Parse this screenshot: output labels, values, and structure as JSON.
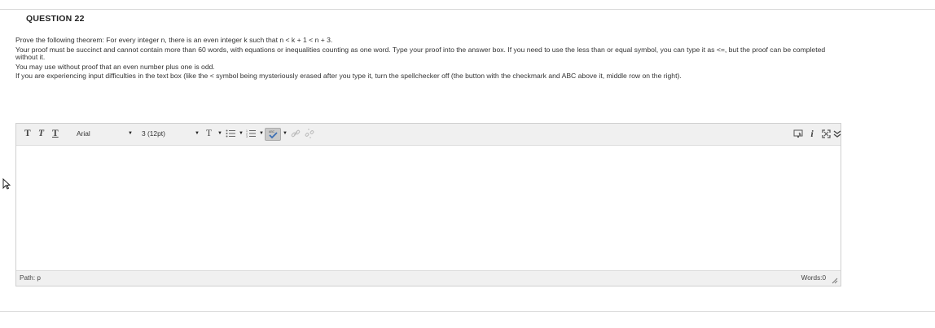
{
  "question": {
    "title": "QUESTION 22",
    "paragraphs": [
      "Prove the following theorem: For every integer n, there is an even integer k such that  n < k + 1 < n  + 3.",
      "Your proof must be succinct and cannot contain more than 60 words, with equations or inequalities counting as one word. Type your proof into the answer box. If you need to use the less than or equal symbol, you can type it as <=, but the proof can be completed without it.",
      "You may use without proof that an even number plus one is odd.",
      "If you are experiencing input difficulties in the text box (like the < symbol being mysteriously erased after you type it, turn the spellchecker off (the button with the checkmark and ABC above it, middle row on the right)."
    ]
  },
  "editor": {
    "toolbar": {
      "text_buttons": [
        "T",
        "T",
        "T"
      ],
      "font_family": "Arial",
      "font_size": "3 (12pt)",
      "color_button": "T",
      "icons": [
        "bold-t-icon",
        "italic-t-icon",
        "underline-t-icon",
        "font-color-icon",
        "bullet-list-icon",
        "numbered-list-icon",
        "spellcheck-icon",
        "link-icon",
        "unlink-icon",
        "preview-icon",
        "info-icon",
        "fullscreen-icon",
        "collapse-icon"
      ],
      "info_label": "i"
    },
    "content": "",
    "status": {
      "path": "Path: p",
      "words": "Words:0"
    }
  }
}
